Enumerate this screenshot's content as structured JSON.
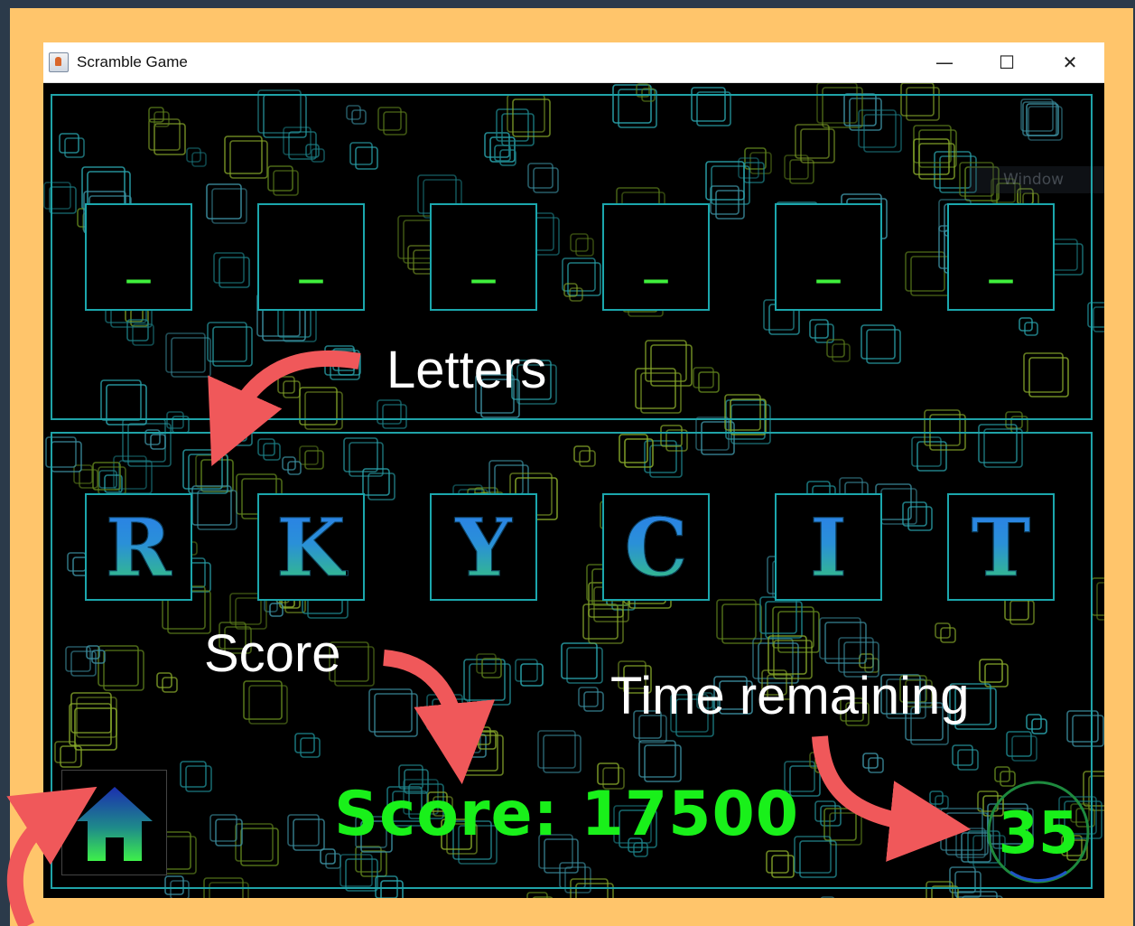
{
  "window": {
    "title": "Scramble Game",
    "minimize_label": "—",
    "maximize_label": "☐",
    "close_label": "✕"
  },
  "colors": {
    "page_bg": "#ffc56b",
    "game_bg": "#000000",
    "slot_border": "#1ba7ad",
    "score_green": "#19f01a",
    "arrow": "#f0585a"
  },
  "answer_slots": [
    "_",
    "_",
    "_",
    "_",
    "_",
    "_"
  ],
  "letter_tiles": [
    "R",
    "K",
    "Y",
    "C",
    "I",
    "T"
  ],
  "score": {
    "text": "Score: 17500"
  },
  "timer": {
    "remaining": "35"
  },
  "home_button": {
    "icon": "home-icon"
  },
  "ghost_label": "Window",
  "annotations": {
    "letters": "Letters",
    "score": "Score",
    "time": "Time remaining"
  }
}
